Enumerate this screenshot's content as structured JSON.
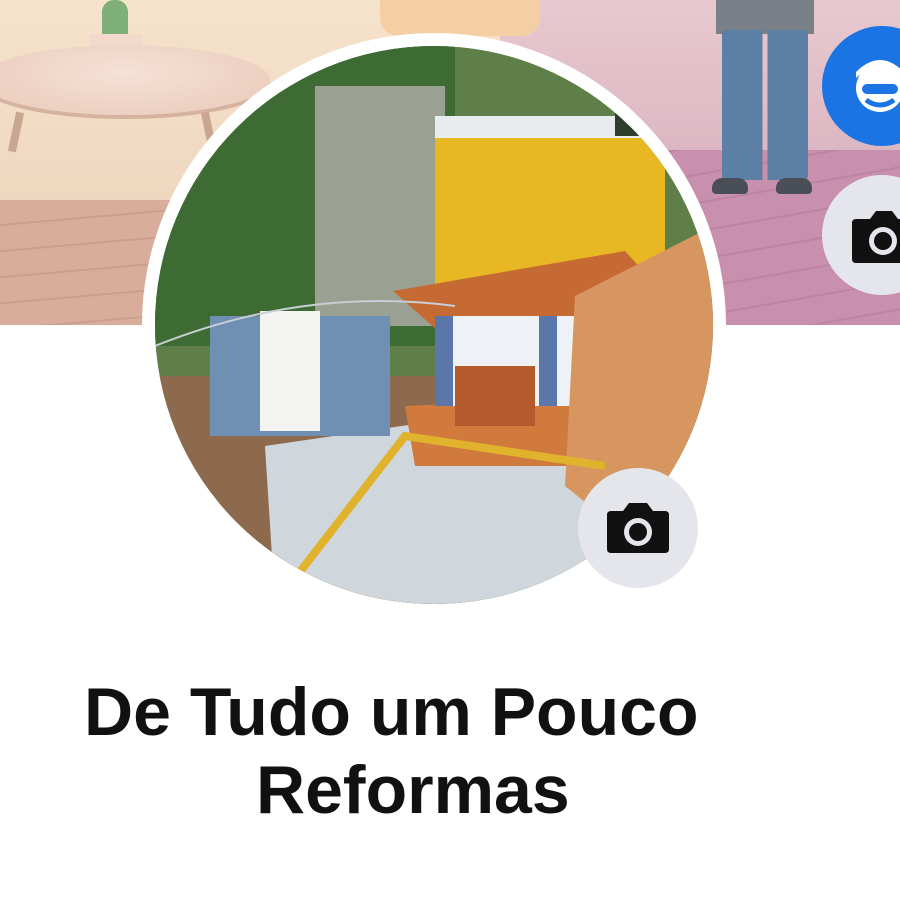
{
  "profile": {
    "name_line_1": "De Tudo um Pouco",
    "name_line_2": "Reformas"
  },
  "icons": {
    "cover_avatar_button": "avatar-icon",
    "cover_camera_button": "camera-icon",
    "profile_camera_button": "camera-icon"
  },
  "colors": {
    "accent": "#1b74e4",
    "icon_button_bg": "#e4e6eb",
    "text": "#111111"
  }
}
